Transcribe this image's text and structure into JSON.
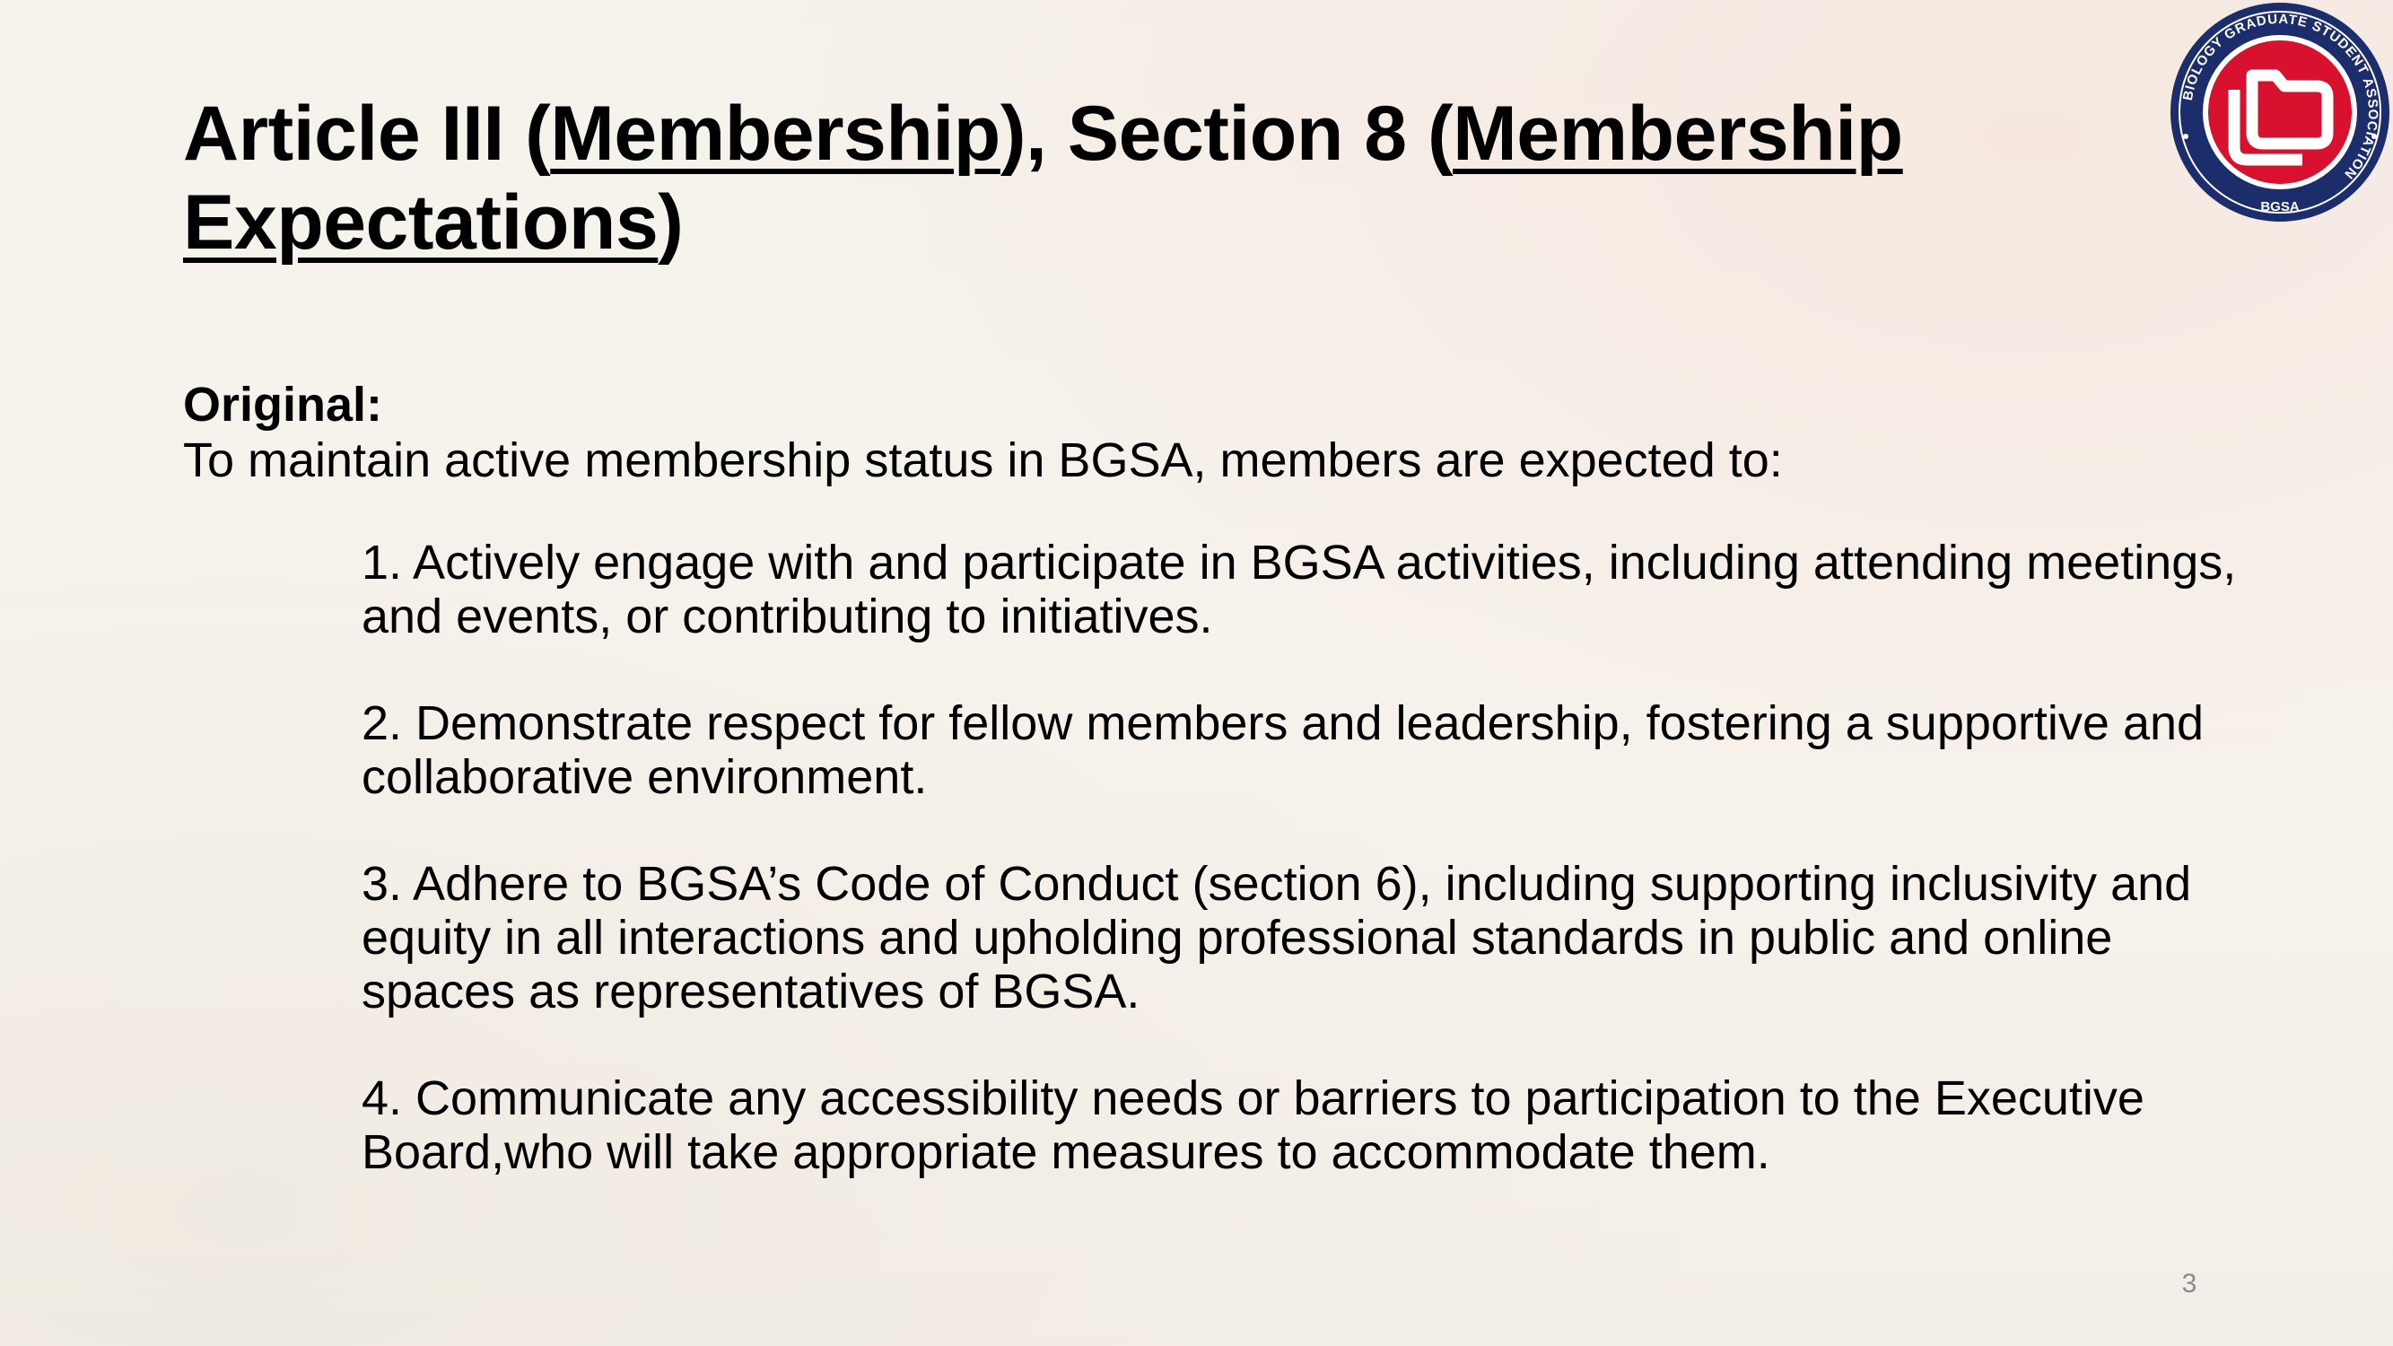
{
  "slide": {
    "title_parts": {
      "p1": "Article III (",
      "p2": "Membership",
      "p3": "), Section 8 (",
      "p4": "Membership Expectations",
      "p5": ")"
    },
    "section_heading": "Original:",
    "intro": "To maintain active membership status in BGSA, members are expected to:",
    "items": [
      "1. Actively engage with and participate in BGSA activities, including attending meetings, and events, or contributing to initiatives.",
      "2. Demonstrate respect for fellow members and leadership, fostering a supportive and collaborative environment.",
      "3. Adhere to BGSA’s Code of Conduct (section 6), including supporting inclusivity and equity in all interactions and upholding professional standards in public and online spaces as representatives of BGSA.",
      "4. Communicate any accessibility needs or barriers to participation to the Executive Board,who will take appropriate measures to accommodate them."
    ],
    "page_number": "3"
  },
  "logo": {
    "ring_text": "BIOLOGY GRADUATE STUDENT ASSOCIATION",
    "bottom_text": "BGSA",
    "colors": {
      "ring": "#1c2d6b",
      "center": "#d8112e",
      "icon": "#ffffff"
    }
  }
}
